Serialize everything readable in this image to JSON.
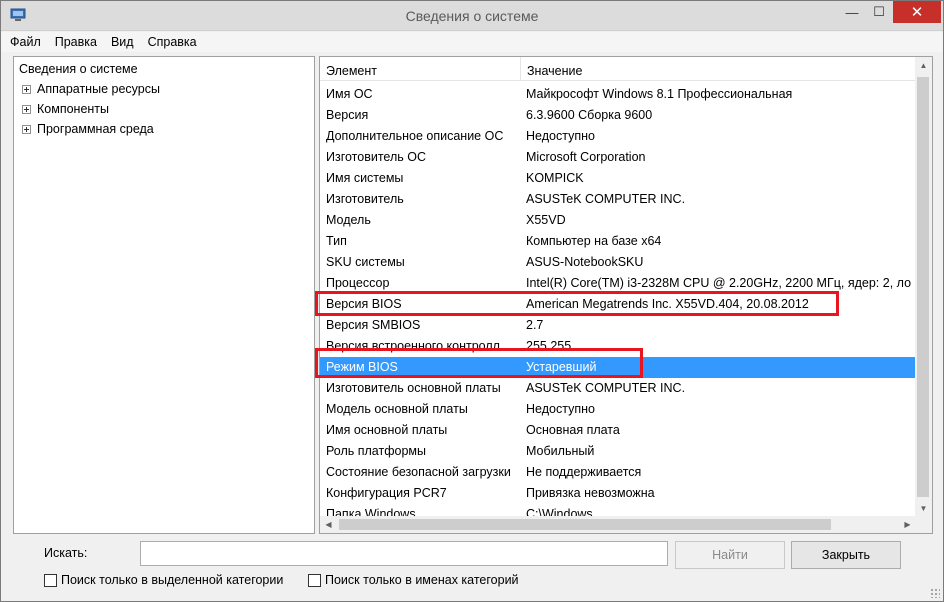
{
  "window": {
    "title": "Сведения о системе",
    "controls": {
      "minimize": "—",
      "maximize": "☐",
      "close": "✕"
    }
  },
  "menu": [
    "Файл",
    "Правка",
    "Вид",
    "Справка"
  ],
  "tree": {
    "root": "Сведения о системе",
    "children": [
      "Аппаратные ресурсы",
      "Компоненты",
      "Программная среда"
    ]
  },
  "table": {
    "headers": [
      "Элемент",
      "Значение"
    ],
    "rows": [
      [
        "Имя ОС",
        "Майкрософт Windows 8.1 Профессиональная"
      ],
      [
        "Версия",
        "6.3.9600 Сборка 9600"
      ],
      [
        "Дополнительное описание ОС",
        "Недоступно"
      ],
      [
        "Изготовитель ОС",
        "Microsoft Corporation"
      ],
      [
        "Имя системы",
        "KOMPICK"
      ],
      [
        "Изготовитель",
        "ASUSTeK COMPUTER INC."
      ],
      [
        "Модель",
        "X55VD"
      ],
      [
        "Тип",
        "Компьютер на базе x64"
      ],
      [
        "SKU системы",
        "ASUS-NotebookSKU"
      ],
      [
        "Процессор",
        "Intel(R) Core(TM) i3-2328M CPU @ 2.20GHz, 2200 МГц, ядер: 2, ло"
      ],
      [
        "Версия BIOS",
        "American Megatrends Inc. X55VD.404, 20.08.2012"
      ],
      [
        "Версия SMBIOS",
        "2.7"
      ],
      [
        "Версия встроенного контролл...",
        "255.255"
      ],
      [
        "Режим BIOS",
        "Устаревший"
      ],
      [
        "Изготовитель основной платы",
        "ASUSTeK COMPUTER INC."
      ],
      [
        "Модель основной платы",
        "Недоступно"
      ],
      [
        "Имя основной платы",
        "Основная плата"
      ],
      [
        "Роль платформы",
        "Мобильный"
      ],
      [
        "Состояние безопасной загрузки",
        "Не поддерживается"
      ],
      [
        "Конфигурация PCR7",
        "Привязка невозможна"
      ],
      [
        "Папка Windows",
        "C:\\Windows"
      ]
    ],
    "selected_row": "Режим BIOS"
  },
  "search": {
    "label": "Искать:",
    "value": "",
    "find_button": "Найти",
    "close_button": "Закрыть",
    "checkbox_selected_category": "Поиск только в выделенной категории",
    "checkbox_category_names": "Поиск только в именах категорий"
  },
  "colors": {
    "selection": "#3399ff",
    "highlight_box": "#e8141e",
    "close_button": "#c7302a"
  }
}
